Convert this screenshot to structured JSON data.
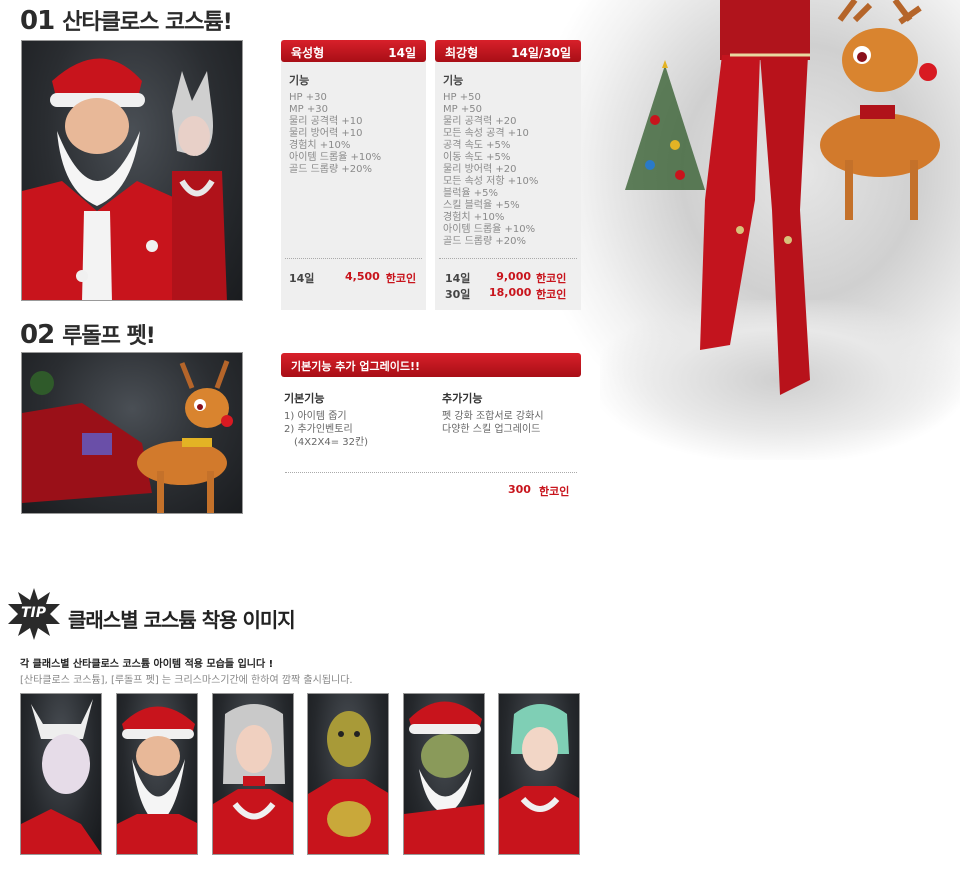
{
  "section1": {
    "num": "01",
    "title": "산타클로스 코스튬!"
  },
  "section2": {
    "num": "02",
    "title": "루돌프 펫!"
  },
  "card_grow": {
    "name": "육성형",
    "period": "14일",
    "caption": "기능",
    "stats": [
      "HP +30",
      "MP +30",
      "물리 공격력 +10",
      "물리 방어력 +10",
      "경험치 +10%",
      "아이템 드롭율 +10%",
      "골드 드롭량 +20%"
    ],
    "prices": [
      {
        "days": "14일",
        "amount": "4,500",
        "unit": "한코인"
      }
    ]
  },
  "card_strong": {
    "name": "최강형",
    "period": "14일/30일",
    "caption": "기능",
    "stats": [
      "HP +50",
      "MP +50",
      "물리 공격력 +20",
      "모든 속성 공격 +10",
      "공격 속도 +5%",
      "이동 속도 +5%",
      "물리 방어력 +20",
      "모든 속성 저항 +10%",
      "블럭율 +5%",
      "스킬 블럭율 +5%",
      "경험치 +10%",
      "아이템 드롭율 +10%",
      "골드 드롭량 +20%"
    ],
    "prices": [
      {
        "days": "14일",
        "amount": "9,000",
        "unit": "한코인"
      },
      {
        "days": "30일",
        "amount": "18,000",
        "unit": "한코인"
      }
    ]
  },
  "upgrade": {
    "header": "기본기능 추가 업그레이드!!",
    "basic_caption": "기본기능",
    "basic_items": [
      "1) 아이템 줍기",
      "2) 추가인벤토리",
      "(4X2X4= 32칸)"
    ],
    "extra_caption": "추가기능",
    "extra_items": [
      "펫 강화 조합서로 강화시",
      "다양한 스킬 업그레이드"
    ],
    "price": {
      "amount": "300",
      "unit": "한코인"
    }
  },
  "tip": {
    "badge": "TIP",
    "title": "클래스별 코스튬 착용 이미지",
    "desc1": "각 클래스별 산타클로스 코스튬 아이템 적용 모습들 입니다 !",
    "desc2": "[산타클로스 코스튬], [루돌프 펫] 는 크리스마스기간에 한하여  깜짝 출시됩니다."
  },
  "colors": {
    "accent_red": "#c8141c",
    "header_red": "#d8202a",
    "card_bg": "#efefef"
  }
}
